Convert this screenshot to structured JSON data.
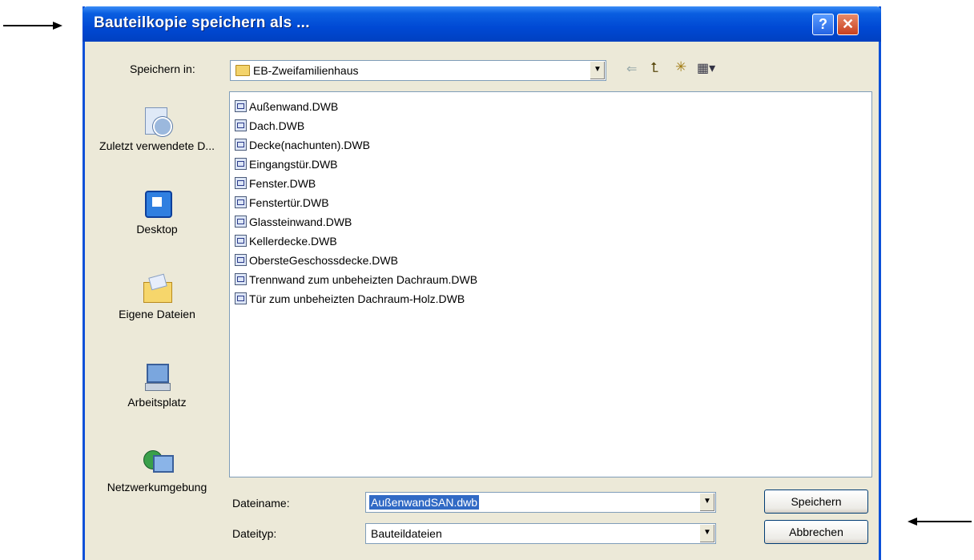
{
  "dialog": {
    "title": "Bauteilkopie speichern als ...",
    "help_glyph": "?",
    "close_glyph": "✕"
  },
  "toolbar": {
    "save_in_label": "Speichern in:",
    "save_in_value": "EB-Zweifamilienhaus",
    "dropdown_glyph": "▼",
    "back_glyph": "⇐",
    "up_glyph": "⮤",
    "newfolder_glyph": "✳",
    "view_glyph": "▦▾"
  },
  "places": [
    {
      "label": "Zuletzt verwendete D...",
      "icon": "recent-icon"
    },
    {
      "label": "Desktop",
      "icon": "desktop-icon"
    },
    {
      "label": "Eigene Dateien",
      "icon": "my-documents-icon"
    },
    {
      "label": "Arbeitsplatz",
      "icon": "my-computer-icon"
    },
    {
      "label": "Netzwerkumgebung",
      "icon": "network-icon"
    }
  ],
  "files": [
    "Außenwand.DWB",
    "Dach.DWB",
    "Decke(nachunten).DWB",
    "Eingangstür.DWB",
    "Fenster.DWB",
    "Fenstertür.DWB",
    "Glassteinwand.DWB",
    "Kellerdecke.DWB",
    "ObersteGeschossdecke.DWB",
    "Trennwand zum unbeheizten Dachraum.DWB",
    "Tür zum unbeheizten Dachraum-Holz.DWB"
  ],
  "form": {
    "filename_label": "Dateiname:",
    "filename_value": "AußenwandSAN.dwb",
    "filetype_label": "Dateityp:",
    "filetype_value": "Bauteildateien"
  },
  "buttons": {
    "save": "Speichern",
    "cancel": "Abbrechen"
  }
}
